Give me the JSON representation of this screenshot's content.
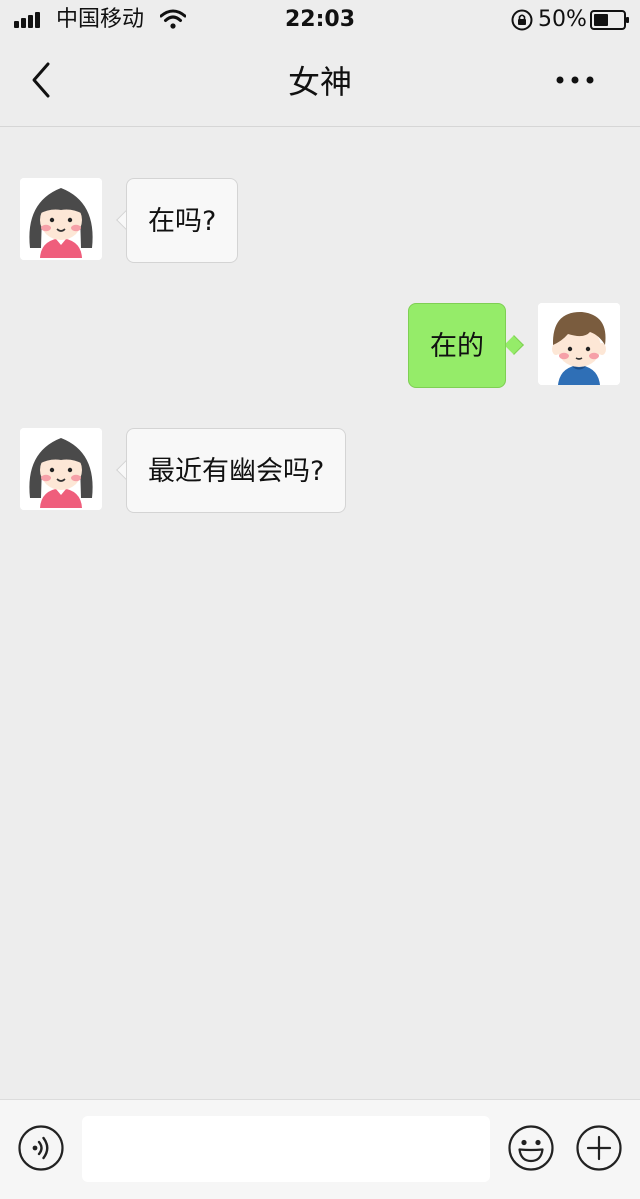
{
  "status_bar": {
    "carrier": "中国移动",
    "time": "22:03",
    "battery_percent": "50%",
    "battery_level": 0.5,
    "signal_icon": "signal-bars-icon",
    "wifi_icon": "wifi-icon",
    "lock_icon": "orientation-lock-icon"
  },
  "nav": {
    "title": "女神",
    "back_icon": "chevron-left-icon",
    "more_icon": "more-dots-icon"
  },
  "messages": [
    {
      "from": "her",
      "text": "在吗?"
    },
    {
      "from": "me",
      "text": "在的"
    },
    {
      "from": "her",
      "text": "最近有幽会吗?"
    }
  ],
  "input_bar": {
    "value": "",
    "placeholder": "",
    "voice_icon": "voice-icon",
    "emoji_icon": "emoji-icon",
    "plus_icon": "plus-circle-icon"
  },
  "colors": {
    "background": "#ededed",
    "sent_bubble": "#95ec69",
    "received_bubble": "#f8f8f8"
  }
}
